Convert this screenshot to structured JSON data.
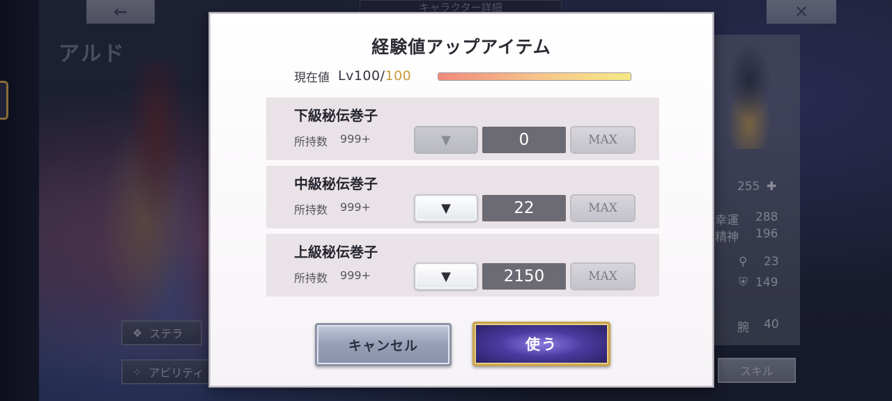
{
  "background": {
    "back_icon": "←",
    "close_icon": "✕",
    "header_title": "キャラクター詳細",
    "character_name": "アルド",
    "stella_label": "ステラ",
    "ability_label": "アビリティ",
    "skill_label": "スキル",
    "stats": {
      "top_value": "255",
      "plus_icon": "✚",
      "luck_label": "幸運",
      "luck_value": "288",
      "spirit_label": "精神",
      "spirit_value": "196",
      "stat_a_value": "23",
      "stat_b_value": "149",
      "arm_label": "腕",
      "arm_value": "40"
    }
  },
  "modal": {
    "title": "経験値アップアイテム",
    "current_label": "現在値",
    "level_text": "Lv100/",
    "level_max": "100",
    "exp_fill_fraction": 1.0,
    "items": [
      {
        "name": "下級秘伝巻子",
        "owned_label": "所持数",
        "owned_count": "999+",
        "quantity": "0",
        "decrement_disabled": true,
        "max_label": "MAX",
        "decrement_icon": "▼"
      },
      {
        "name": "中級秘伝巻子",
        "owned_label": "所持数",
        "owned_count": "999+",
        "quantity": "22",
        "decrement_disabled": false,
        "max_label": "MAX",
        "decrement_icon": "▼"
      },
      {
        "name": "上級秘伝巻子",
        "owned_label": "所持数",
        "owned_count": "999+",
        "quantity": "2150",
        "decrement_disabled": false,
        "max_label": "MAX",
        "decrement_icon": "▼"
      }
    ],
    "cancel_label": "キャンセル",
    "use_label": "使う"
  }
}
